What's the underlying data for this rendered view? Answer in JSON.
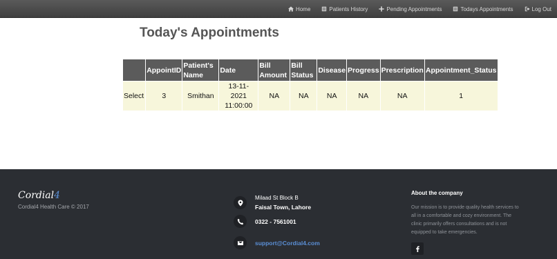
{
  "nav": {
    "items": [
      {
        "label": "Home",
        "icon": "home-icon"
      },
      {
        "label": "Patients History",
        "icon": "list-icon"
      },
      {
        "label": "Pending Appointments",
        "icon": "plus-icon"
      },
      {
        "label": "Todays Appointments",
        "icon": "list-icon"
      },
      {
        "label": "Log Out",
        "icon": "logout-icon"
      }
    ]
  },
  "main": {
    "title": "Today's Appointments",
    "table": {
      "headers": [
        "",
        "AppointID",
        "Patient's Name",
        "Date",
        "Bill Amount",
        "Bill Status",
        "Disease",
        "Progress",
        "Prescription",
        "Appointment_Status"
      ],
      "rows": [
        {
          "select": "Select",
          "appoint_id": "3",
          "patient_name": "Smithan",
          "date": "13-11-2021 11:00:00",
          "bill_amount": "NA",
          "bill_status": "NA",
          "disease": "NA",
          "progress": "NA",
          "prescription": "NA",
          "appointment_status": "1"
        }
      ]
    }
  },
  "footer": {
    "brand": "Cordial",
    "brand_num": "4",
    "copyright": "Cordial4 Health Care © 2017",
    "address_line1": "Milaad St Block B",
    "address_line2": "Faisal Town, Lahore",
    "phone": "0322 - 7561001",
    "email": "support@Cordial4.com",
    "about_title": "About the company",
    "about_text": "Our mission is to provide quality health services to all in a comfortable and cozy environment. The clinic primarily offers consultations and is not equipped to take emergencies."
  }
}
